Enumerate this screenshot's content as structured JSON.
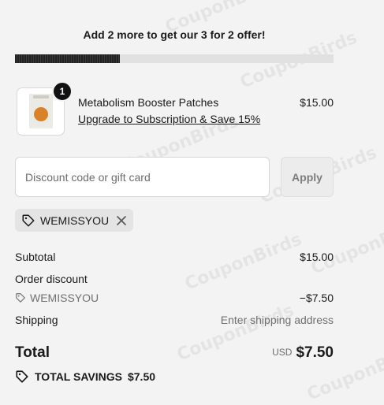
{
  "banner": {
    "text": "Add 2 more to get our 3 for 2 offer!",
    "progress": 0.33
  },
  "line_item": {
    "quantity": "1",
    "name": "Metabolism Booster Patches",
    "upgrade_link": "Upgrade to Subscription & Save 15%",
    "price": "$15.00",
    "image_icon": "patch-pack-image"
  },
  "discount": {
    "placeholder": "Discount code or gift card",
    "apply_label": "Apply",
    "applied_code": "WEMISSYOU"
  },
  "summary": {
    "subtotal_label": "Subtotal",
    "subtotal_value": "$15.00",
    "order_discount_label": "Order discount",
    "discount_code": "WEMISSYOU",
    "discount_value": "−$7.50",
    "shipping_label": "Shipping",
    "shipping_value": "Enter shipping address",
    "total_label": "Total",
    "currency": "USD",
    "total_value": "$7.50",
    "savings_label": "TOTAL SAVINGS",
    "savings_value": "$7.50"
  },
  "watermark": "CouponBirds",
  "colors": {
    "background": "#f3f3f3",
    "progress": "#222222",
    "muted": "#707070"
  }
}
